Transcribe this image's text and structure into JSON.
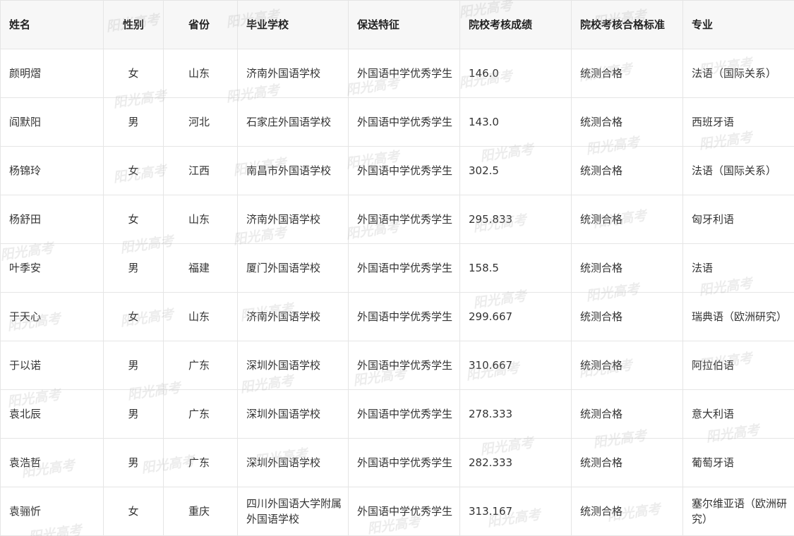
{
  "table": {
    "headers": [
      "姓名",
      "性别",
      "省份",
      "毕业学校",
      "保送特征",
      "院校考核成绩",
      "院校考核合格标准",
      "专业"
    ],
    "rows": [
      [
        "颜明熠",
        "女",
        "山东",
        "济南外国语学校",
        "外国语中学优秀学生",
        "146.0",
        "统测合格",
        "法语（国际关系）"
      ],
      [
        "阎默阳",
        "男",
        "河北",
        "石家庄外国语学校",
        "外国语中学优秀学生",
        "143.0",
        "统测合格",
        "西班牙语"
      ],
      [
        "杨锦玲",
        "女",
        "江西",
        "南昌市外国语学校",
        "外国语中学优秀学生",
        "302.5",
        "统测合格",
        "法语（国际关系）"
      ],
      [
        "杨舒田",
        "女",
        "山东",
        "济南外国语学校",
        "外国语中学优秀学生",
        "295.833",
        "统测合格",
        "匈牙利语"
      ],
      [
        "叶季安",
        "男",
        "福建",
        "厦门外国语学校",
        "外国语中学优秀学生",
        "158.5",
        "统测合格",
        "法语"
      ],
      [
        "于天心",
        "女",
        "山东",
        "济南外国语学校",
        "外国语中学优秀学生",
        "299.667",
        "统测合格",
        "瑞典语（欧洲研究）"
      ],
      [
        "于以诺",
        "男",
        "广东",
        "深圳外国语学校",
        "外国语中学优秀学生",
        "310.667",
        "统测合格",
        "阿拉伯语"
      ],
      [
        "袁北辰",
        "男",
        "广东",
        "深圳外国语学校",
        "外国语中学优秀学生",
        "278.333",
        "统测合格",
        "意大利语"
      ],
      [
        "袁浩哲",
        "男",
        "广东",
        "深圳外国语学校",
        "外国语中学优秀学生",
        "282.333",
        "统测合格",
        "葡萄牙语"
      ],
      [
        "袁骊忻",
        "女",
        "重庆",
        "四川外国语大学附属外国语学校",
        "外国语中学优秀学生",
        "313.167",
        "统测合格",
        "塞尔维亚语（欧洲研究）"
      ]
    ]
  },
  "watermark": {
    "text": "阳光高考"
  }
}
